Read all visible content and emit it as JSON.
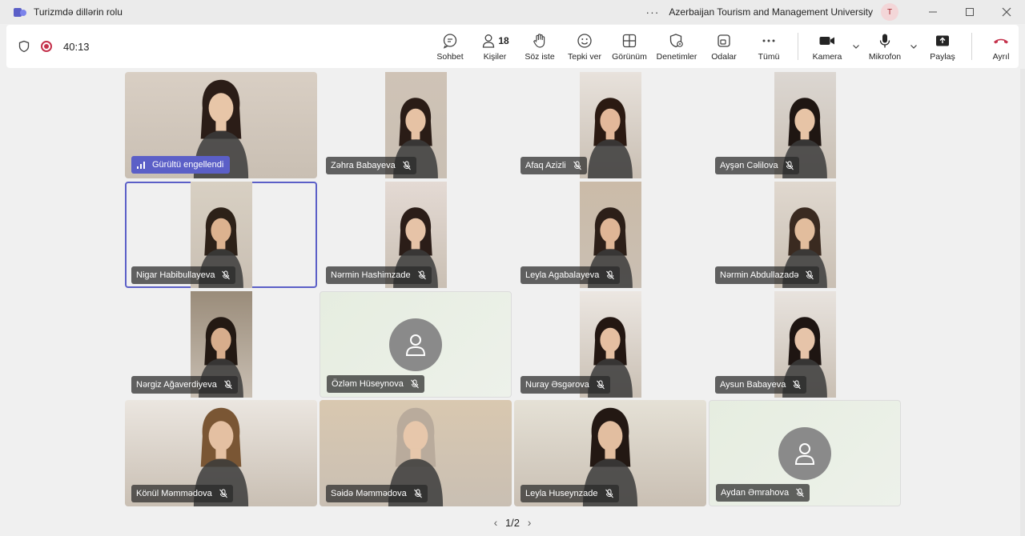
{
  "window": {
    "title": "Turizmdə dillərin rolu",
    "more_icon": "more-horizontal-icon",
    "org_name": "Azerbaijan Tourism and Management University",
    "org_avatar": "T",
    "controls": [
      "minimize",
      "maximize",
      "close"
    ]
  },
  "meeting_bar": {
    "timer": "40:13",
    "tools": [
      {
        "id": "chat",
        "label": "Sohbet",
        "icon": "chat-icon"
      },
      {
        "id": "people",
        "label": "Kişiler",
        "icon": "people-icon",
        "count": "18"
      },
      {
        "id": "raise-hand",
        "label": "Söz iste",
        "icon": "hand-icon"
      },
      {
        "id": "react",
        "label": "Tepki ver",
        "icon": "smile-icon"
      },
      {
        "id": "view",
        "label": "Görünüm",
        "icon": "grid-icon"
      },
      {
        "id": "controls",
        "label": "Denetimler",
        "icon": "shield-gear-icon"
      },
      {
        "id": "rooms",
        "label": "Odalar",
        "icon": "rooms-icon"
      },
      {
        "id": "more",
        "label": "Tümü",
        "icon": "more-icon"
      }
    ],
    "camera_label": "Kamera",
    "mic_label": "Mikrofon",
    "share_label": "Paylaş",
    "leave_label": "Ayrıl"
  },
  "participants": [
    {
      "name": "",
      "status": "Gürültü engellendi",
      "bg": "#d9cfc4",
      "skin": "#e8c6a8",
      "hair": "#2b1d17"
    },
    {
      "name": "Zəhra Babayeva",
      "bg": "#cfc3b6",
      "skin": "#e6c2a4",
      "hair": "#2a1c16"
    },
    {
      "name": "Afaq Azizli",
      "bg": "#e8e2dc",
      "skin": "#e3b89a",
      "hair": "#2b1a12"
    },
    {
      "name": "Ayşən Cəlilova",
      "bg": "#dcd7d2",
      "skin": "#e7c4a6",
      "hair": "#1f1612"
    },
    {
      "name": "Nigar Habibullayeva",
      "bg": "#d8d0c3",
      "skin": "#dcb28f",
      "hair": "#2d2118"
    },
    {
      "name": "Nərmin Hashimzade",
      "bg": "#e4dad4",
      "skin": "#e6c3a7",
      "hair": "#2b1d18"
    },
    {
      "name": "Leyla Agabalayeva",
      "bg": "#cbbba8",
      "skin": "#dfb696",
      "hair": "#2c1f18"
    },
    {
      "name": "Nərmin Abdullazadə",
      "bg": "#e0d8cf",
      "skin": "#e2bd9d",
      "hair": "#3a2a20"
    },
    {
      "name": "Nərgiz Ağaverdiyeva",
      "bg": "#9a8c7a",
      "skin": "#d7ad8c",
      "hair": "#231913"
    },
    {
      "name": "Özləm Hüseynova",
      "avatar": true
    },
    {
      "name": "Nuray Əsgərova",
      "bg": "#ece7e2",
      "skin": "#e5bfa1",
      "hair": "#231712"
    },
    {
      "name": "Aysun Babayeva",
      "bg": "#e8e3de",
      "skin": "#e6c4a9",
      "hair": "#1e1512"
    },
    {
      "name": "Könül Məmmədova",
      "bg": "#ebe6e0",
      "skin": "#e4c0a2",
      "hair": "#7a5634"
    },
    {
      "name": "Səidə Məmmədova",
      "bg": "#d9c8b0",
      "skin": "#e7c7ab",
      "hair": "#b9ab9c"
    },
    {
      "name": "Leyla Huseynzade",
      "bg": "#e5e1d6",
      "skin": "#e2bea0",
      "hair": "#231813"
    },
    {
      "name": "Aydan Əmrahova",
      "avatar": true
    }
  ],
  "pager": {
    "text": "1/2"
  }
}
